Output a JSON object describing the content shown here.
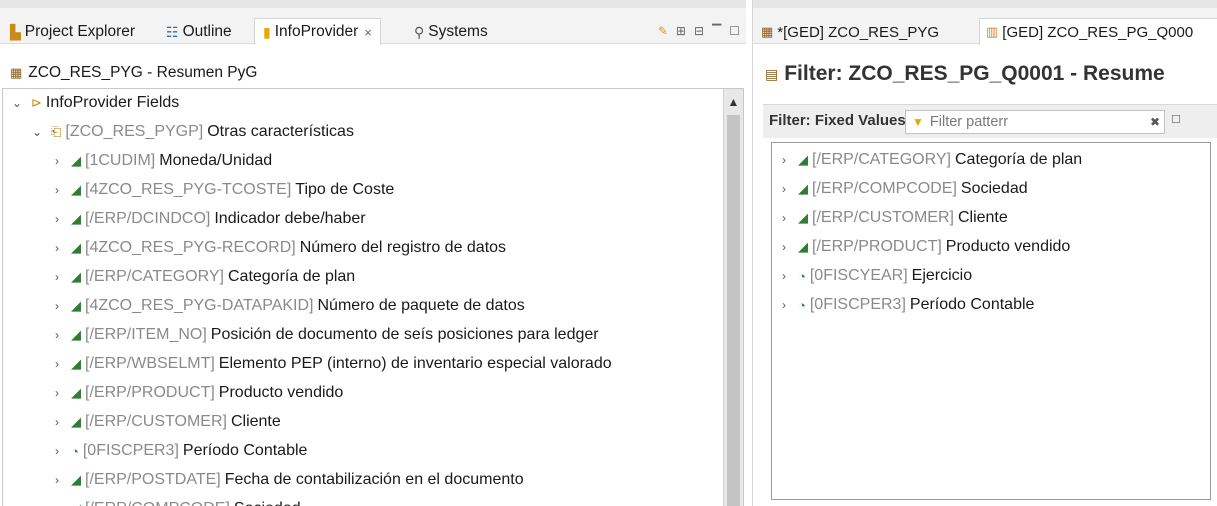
{
  "left": {
    "tabs": [
      {
        "label": "Project Explorer",
        "icon": "project-explorer-icon"
      },
      {
        "label": "Outline",
        "icon": "outline-icon"
      },
      {
        "label": "InfoProvider",
        "icon": "infoprovider-icon",
        "active": true,
        "close": "×"
      },
      {
        "label": "Systems",
        "icon": "systems-icon"
      }
    ],
    "provider_title": "ZCO_RES_PYG - Resumen PyG",
    "tree": [
      {
        "level": 0,
        "chevron": "⌄",
        "icon": "folder-icon",
        "code": "",
        "desc": "InfoProvider Fields"
      },
      {
        "level": 1,
        "chevron": "⌄",
        "icon": "group-icon",
        "code": "[ZCO_RES_PYGP]",
        "desc": "Otras características"
      },
      {
        "level": 2,
        "chevron": "›",
        "icon": "characteristic-icon",
        "code": "[1CUDIM]",
        "desc": "Moneda/Unidad"
      },
      {
        "level": 2,
        "chevron": "›",
        "icon": "characteristic-icon",
        "code": "[4ZCO_RES_PYG-TCOSTE]",
        "desc": "Tipo de Coste"
      },
      {
        "level": 2,
        "chevron": "›",
        "icon": "characteristic-icon",
        "code": "[/ERP/DCINDCO]",
        "desc": "Indicador debe/haber"
      },
      {
        "level": 2,
        "chevron": "›",
        "icon": "characteristic-icon",
        "code": "[4ZCO_RES_PYG-RECORD]",
        "desc": "Número del registro de datos"
      },
      {
        "level": 2,
        "chevron": "›",
        "icon": "characteristic-icon",
        "code": "[/ERP/CATEGORY]",
        "desc": "Categoría de plan"
      },
      {
        "level": 2,
        "chevron": "›",
        "icon": "characteristic-icon",
        "code": "[4ZCO_RES_PYG-DATAPAKID]",
        "desc": "Número de paquete de datos"
      },
      {
        "level": 2,
        "chevron": "›",
        "icon": "characteristic-icon",
        "code": "[/ERP/ITEM_NO]",
        "desc": "Posición de documento de seís posiciones para ledger"
      },
      {
        "level": 2,
        "chevron": "›",
        "icon": "characteristic-icon",
        "code": "[/ERP/WBSELMT]",
        "desc": "Elemento PEP (interno) de inventario especial valorado"
      },
      {
        "level": 2,
        "chevron": "›",
        "icon": "characteristic-icon",
        "code": "[/ERP/PRODUCT]",
        "desc": "Producto vendido"
      },
      {
        "level": 2,
        "chevron": "›",
        "icon": "characteristic-icon",
        "code": "[/ERP/CUSTOMER]",
        "desc": "Cliente"
      },
      {
        "level": 2,
        "chevron": "›",
        "icon": "time-characteristic-icon",
        "code": "[0FISCPER3]",
        "desc": "Período Contable"
      },
      {
        "level": 2,
        "chevron": "›",
        "icon": "characteristic-icon",
        "code": "[/ERP/POSTDATE]",
        "desc": "Fecha de contabilización en el documento"
      },
      {
        "level": 2,
        "chevron": "›",
        "icon": "characteristic-icon",
        "code": "[/ERP/COMPCODE]",
        "desc": "Sociedad"
      }
    ]
  },
  "right": {
    "tabs": [
      {
        "label": "*[GED] ZCO_RES_PYG",
        "icon": "infoprovider-editor-icon"
      },
      {
        "label": "[GED] ZCO_RES_PG_Q000",
        "icon": "query-icon",
        "active": true
      }
    ],
    "filter_title": "Filter: ZCO_RES_PG_Q0001 - Resume",
    "fixed_values_label": "Filter: Fixed Values",
    "filter_placeholder": "Filter patterr",
    "fixed_tree": [
      {
        "chevron": "›",
        "icon": "characteristic-icon",
        "code": "[/ERP/CATEGORY]",
        "desc": "Categoría de plan"
      },
      {
        "chevron": "›",
        "icon": "characteristic-icon",
        "code": "[/ERP/COMPCODE]",
        "desc": "Sociedad"
      },
      {
        "chevron": "›",
        "icon": "characteristic-icon",
        "code": "[/ERP/CUSTOMER]",
        "desc": "Cliente"
      },
      {
        "chevron": "›",
        "icon": "characteristic-icon",
        "code": "[/ERP/PRODUCT]",
        "desc": "Producto vendido"
      },
      {
        "chevron": "›",
        "icon": "time-characteristic-icon",
        "code": "[0FISCYEAR]",
        "desc": "Ejercicio"
      },
      {
        "chevron": "›",
        "icon": "time-characteristic-icon",
        "code": "[0FISCPER3]",
        "desc": "Período Contable"
      }
    ]
  }
}
